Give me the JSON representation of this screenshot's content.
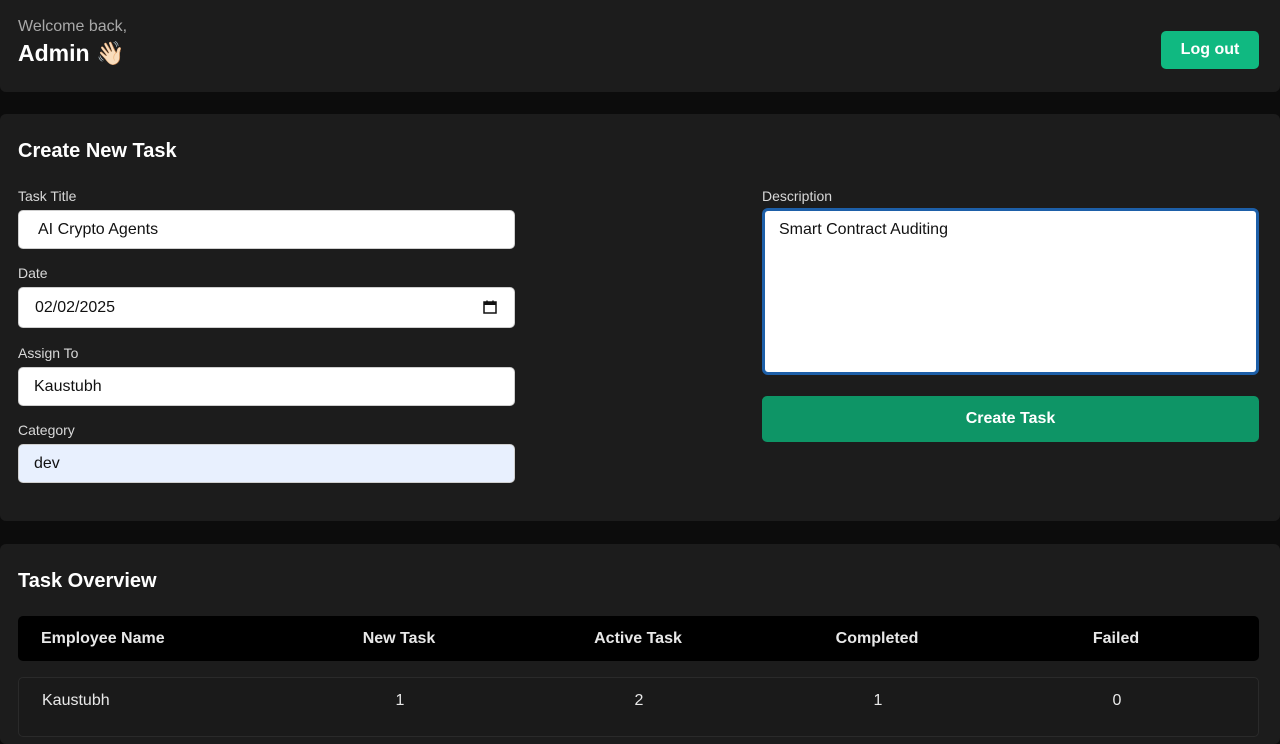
{
  "header": {
    "welcome": "Welcome back,",
    "user": "Admin 👋🏻",
    "logout_label": "Log out"
  },
  "create_task": {
    "title": "Create New Task",
    "task_title_label": "Task Title",
    "task_title_value": "AI Crypto Agents",
    "date_label": "Date",
    "date_value": "02/02/2025",
    "assign_label": "Assign To",
    "assign_value": "Kaustubh",
    "category_label": "Category",
    "category_value": "dev",
    "description_label": "Description",
    "description_value": "Smart Contract Auditing",
    "submit_label": "Create Task"
  },
  "overview": {
    "title": "Task Overview",
    "columns": [
      "Employee Name",
      "New Task",
      "Active Task",
      "Completed",
      "Failed"
    ],
    "rows": [
      {
        "name": "Kaustubh",
        "new": "1",
        "active": "2",
        "completed": "1",
        "failed": "0"
      }
    ]
  },
  "colors": {
    "accent": "#10b981",
    "create_button": "#0e9566",
    "focus_ring": "#1d5fa8",
    "panel": "#1c1c1c",
    "background": "#0c0c0c"
  },
  "icons": {
    "date_picker": "calendar-icon"
  }
}
